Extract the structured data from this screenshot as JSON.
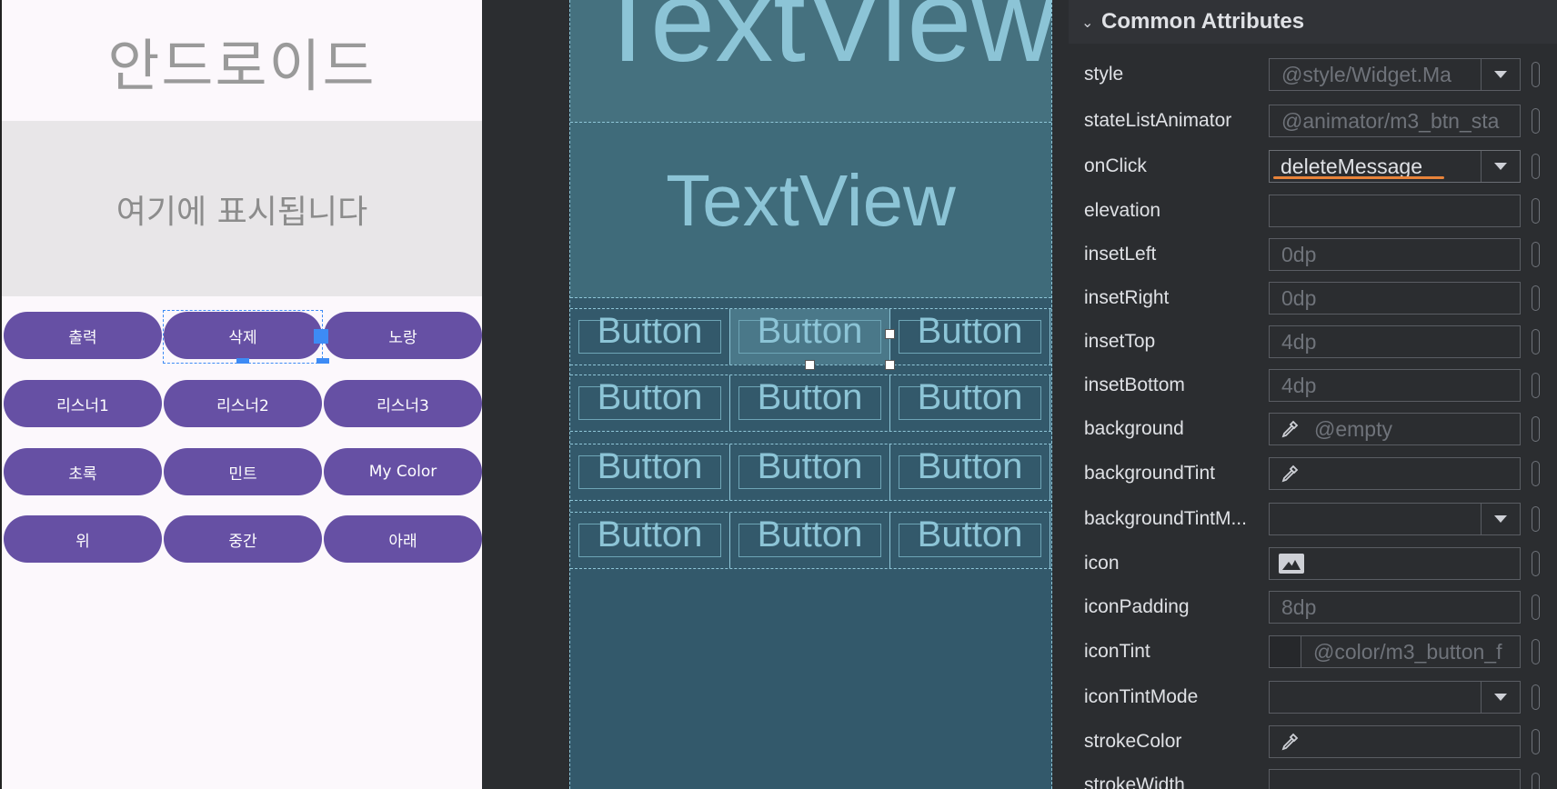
{
  "design": {
    "title": "안드로이드",
    "display_text": "여기에 표시됩니다",
    "buttons": [
      [
        "출력",
        "삭제",
        "노랑"
      ],
      [
        "리스너1",
        "리스너2",
        "리스너3"
      ],
      [
        "초록",
        "민트",
        "My Color"
      ],
      [
        "위",
        "중간",
        "아래"
      ]
    ],
    "button_color": "#6650a4",
    "selected_button": "삭제"
  },
  "blueprint": {
    "title_text": "TextView",
    "display_text": "TextView",
    "button_label": "Button"
  },
  "attributes": {
    "section_title": "Common Attributes",
    "rows": [
      {
        "name": "style",
        "value": "@style/Widget.Ma",
        "control": "dropdown"
      },
      {
        "name": "stateListAnimator",
        "value": "@animator/m3_btn_sta",
        "control": "text"
      },
      {
        "name": "onClick",
        "value": "deleteMessage",
        "control": "dropdown",
        "active": true
      },
      {
        "name": "elevation",
        "value": "",
        "control": "text"
      },
      {
        "name": "insetLeft",
        "value": "0dp",
        "control": "text"
      },
      {
        "name": "insetRight",
        "value": "0dp",
        "control": "text"
      },
      {
        "name": "insetTop",
        "value": "4dp",
        "control": "text"
      },
      {
        "name": "insetBottom",
        "value": "4dp",
        "control": "text"
      },
      {
        "name": "background",
        "value": "@empty",
        "control": "picker"
      },
      {
        "name": "backgroundTint",
        "value": "",
        "control": "picker"
      },
      {
        "name": "backgroundTintM...",
        "value": "",
        "control": "dropdown"
      },
      {
        "name": "icon",
        "value": "",
        "control": "image"
      },
      {
        "name": "iconPadding",
        "value": "8dp",
        "control": "text"
      },
      {
        "name": "iconTint",
        "value": "@color/m3_button_f",
        "control": "swatch"
      },
      {
        "name": "iconTintMode",
        "value": "",
        "control": "dropdown"
      },
      {
        "name": "strokeColor",
        "value": "",
        "control": "picker"
      },
      {
        "name": "strokeWidth",
        "value": "",
        "control": "text"
      }
    ],
    "accent_underline": "#e8833a"
  }
}
